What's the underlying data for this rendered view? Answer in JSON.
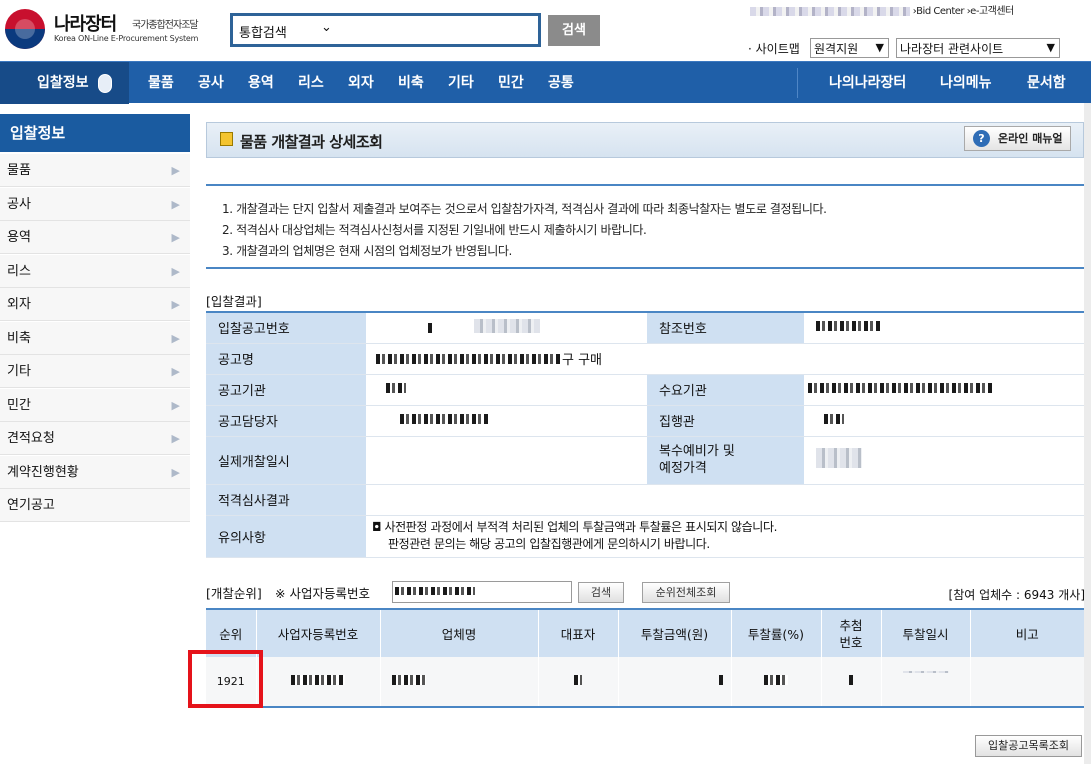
{
  "header": {
    "brand": "나라장터",
    "brand_sub": "국가종합전자조달",
    "brand_en": "Korea ON-Line E-Procurement System",
    "search_scope": "통합검색",
    "search_button": "검색",
    "top_links_tail": "›Bid Center  ›e-고객센터",
    "sitemap": "· 사이트맵",
    "select_support": "원격지원",
    "select_related": "나라장터 관련사이트"
  },
  "nav": {
    "home": "입찰정보",
    "items": [
      "물품",
      "공사",
      "용역",
      "리스",
      "외자",
      "비축",
      "기타",
      "민간",
      "공통"
    ],
    "right": [
      "나의나라장터",
      "나의메뉴",
      "문서함"
    ]
  },
  "sidebar": {
    "title": "입찰정보",
    "items": [
      "물품",
      "공사",
      "용역",
      "리스",
      "외자",
      "비축",
      "기타",
      "민간",
      "견적요청",
      "계약진행현황",
      "연기공고"
    ]
  },
  "page": {
    "title": "물품 개찰결과 상세조회",
    "manual_button": "온라인 매뉴얼",
    "notices": [
      "1. 개찰결과는 단지 입찰서 제출결과 보여주는 것으로서 입찰참가자격, 적격심사 결과에 따라 최종낙찰자는 별도로 결정됩니다.",
      "2. 적격심사 대상업체는 적격심사신청서를 지정된 기일내에 반드시 제출하시기 바랍니다.",
      "3. 개찰결과의 업체명은 현재 시점의 업체정보가 반영됩니다."
    ]
  },
  "result": {
    "section_title": "[입찰결과]",
    "labels": {
      "notice_no": "입찰공고번호",
      "ref_no": "참조번호",
      "notice_name": "공고명",
      "notice_name_tail": "구 구매",
      "agency": "공고기관",
      "demand_agency": "수요기관",
      "officer": "공고담당자",
      "executor": "집행관",
      "open_datetime": "실제개찰일시",
      "multi_price_1": "복수예비가 및",
      "multi_price_2": "예정가격",
      "qualification": "적격심사결과",
      "caution": "유의사항"
    },
    "caution_lines": [
      "◘ 사전판정 과정에서 부적격 처리된 업체의 투찰금액과 투찰률은 표시되지 않습니다.",
      "판정관련 문의는 해당 공고의 입찰집행관에게 문의하시기 바랍니다."
    ]
  },
  "ranking": {
    "section_title": "[개찰순위]",
    "bizno_label": "※ 사업자등록번호",
    "search_button": "검색",
    "all_button": "순위전체조회",
    "count_text": "[참여 업체수 : 6943 개사]",
    "columns": [
      "순위",
      "사업자등록번호",
      "업체명",
      "대표자",
      "투찰금액(원)",
      "투찰률(%)",
      "추첨\n번호",
      "투찰일시",
      "비고"
    ],
    "rows": [
      {
        "rank": "1921"
      }
    ]
  },
  "footer": {
    "list_button": "입찰공고목록조회"
  },
  "colors": {
    "nav_blue": "#1f5fa8",
    "header_cell": "#cfe0f2",
    "highlight": "#e5131a"
  }
}
